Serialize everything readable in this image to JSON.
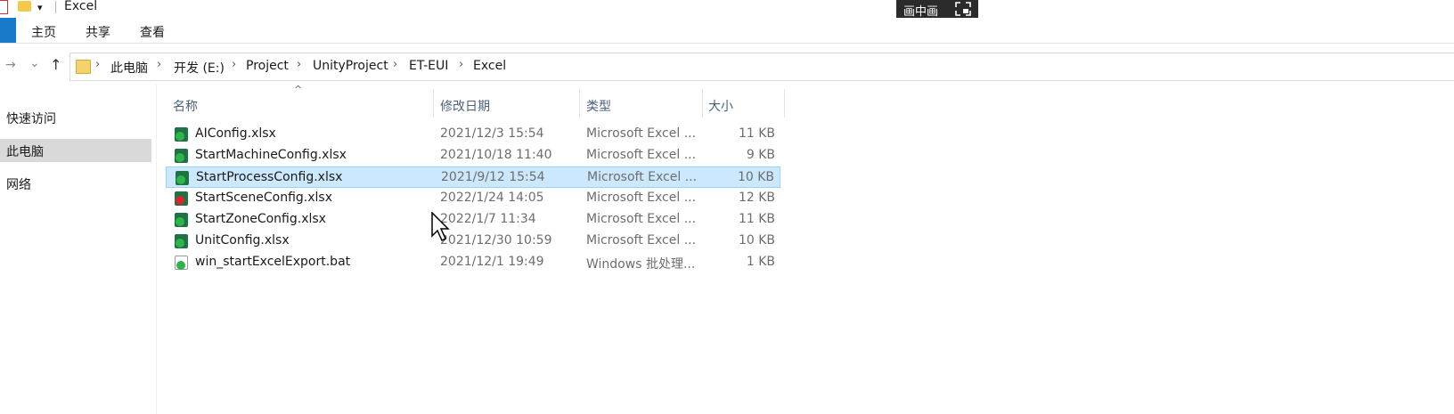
{
  "window": {
    "title": "Excel",
    "qa_dropdown": "▾"
  },
  "pip": {
    "label": "画中画"
  },
  "ribbon": {
    "file_tab": "",
    "tabs": [
      "主页",
      "共享",
      "查看"
    ]
  },
  "nav": {
    "back": "←",
    "forward": "→",
    "history": "⌄",
    "up": "↑"
  },
  "breadcrumb": [
    "此电脑",
    "开发 (E:)",
    "Project",
    "UnityProject",
    "ET-EUI",
    "Excel"
  ],
  "navpane": {
    "items": [
      "快速访问",
      "此电脑",
      "网络"
    ]
  },
  "columns": {
    "name": "名称",
    "date": "修改日期",
    "type": "类型",
    "size": "大小"
  },
  "sort_indicator": "^",
  "files": [
    {
      "name": "AIConfig.xlsx",
      "date": "2021/12/3 15:54",
      "type": "Microsoft Excel ...",
      "size": "11 KB",
      "icon": "excel-synced"
    },
    {
      "name": "StartMachineConfig.xlsx",
      "date": "2021/10/18 11:40",
      "type": "Microsoft Excel ...",
      "size": "9 KB",
      "icon": "excel-synced"
    },
    {
      "name": "StartProcessConfig.xlsx",
      "date": "2021/9/12 15:54",
      "type": "Microsoft Excel ...",
      "size": "10 KB",
      "icon": "excel-synced"
    },
    {
      "name": "StartSceneConfig.xlsx",
      "date": "2022/1/24 14:05",
      "type": "Microsoft Excel ...",
      "size": "12 KB",
      "icon": "excel-error"
    },
    {
      "name": "StartZoneConfig.xlsx",
      "date": "2022/1/7 11:34",
      "type": "Microsoft Excel ...",
      "size": "11 KB",
      "icon": "excel-synced"
    },
    {
      "name": "UnitConfig.xlsx",
      "date": "2021/12/30 10:59",
      "type": "Microsoft Excel ...",
      "size": "10 KB",
      "icon": "excel-synced"
    },
    {
      "name": "win_startExcelExport.bat",
      "date": "2021/12/1 19:49",
      "type": "Windows 批处理...",
      "size": "1 KB",
      "icon": "bat-synced"
    }
  ],
  "colors": {
    "selection_bg": "#cce8ff",
    "selection_border": "#99d1ff",
    "file_tab": "#1979ca"
  }
}
